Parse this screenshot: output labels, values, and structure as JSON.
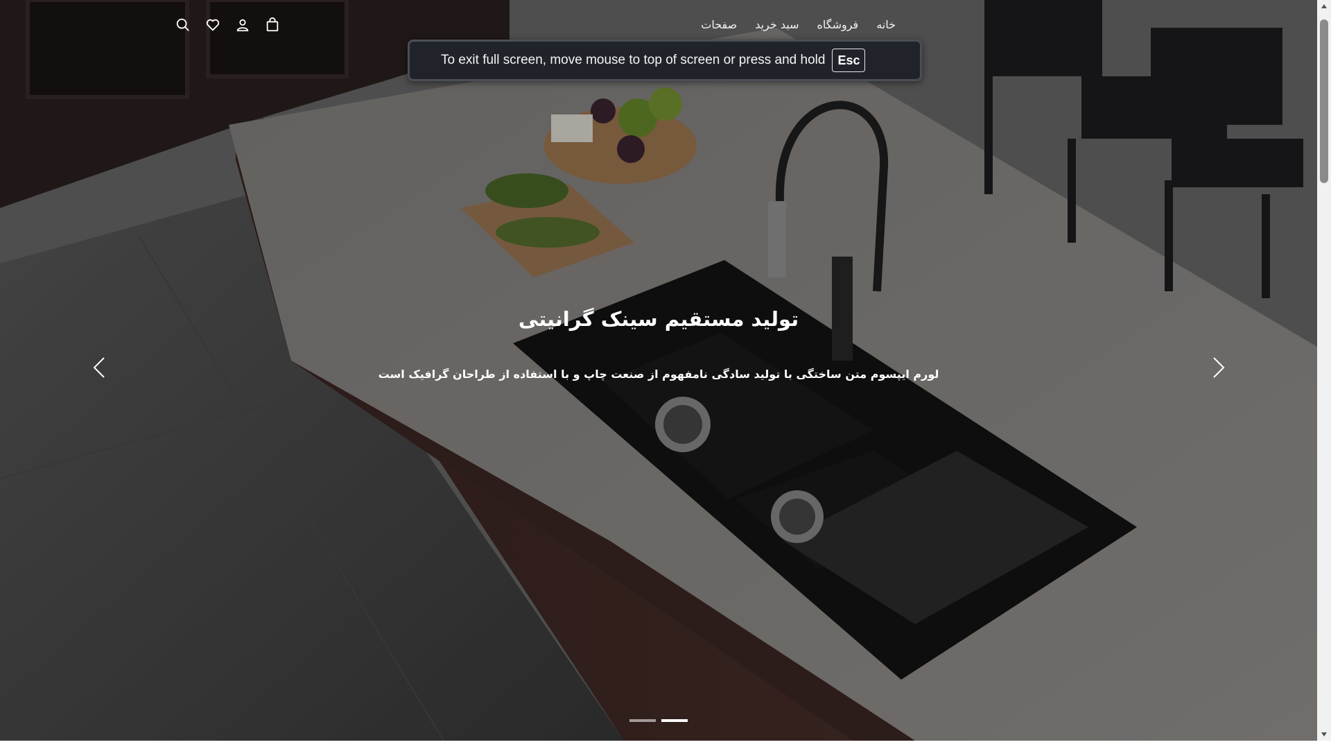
{
  "nav": {
    "links": [
      {
        "label": "خانه"
      },
      {
        "label": "فروشگاه"
      },
      {
        "label": "سبد خرید"
      },
      {
        "label": "صفحات"
      }
    ],
    "icons": [
      "search-icon",
      "heart-icon",
      "user-icon",
      "shopping-bag-icon"
    ]
  },
  "fullscreen_notice": {
    "text": "To exit full screen, move mouse to top of screen or press and hold",
    "key": "Esc"
  },
  "hero": {
    "title": "تولید مستقیم سینک گرانیتی",
    "subtitle": "لورم ایپسوم متن ساختگی با تولید سادگی نامفهوم از صنعت چاپ و با استفاده از طراحان گرافیک است",
    "slides_count": 2,
    "active_slide": 2
  },
  "colors": {
    "text": "#ffffff",
    "banner_bg": "#20232a",
    "countertop": "#8c8884",
    "sink": "#151515"
  }
}
